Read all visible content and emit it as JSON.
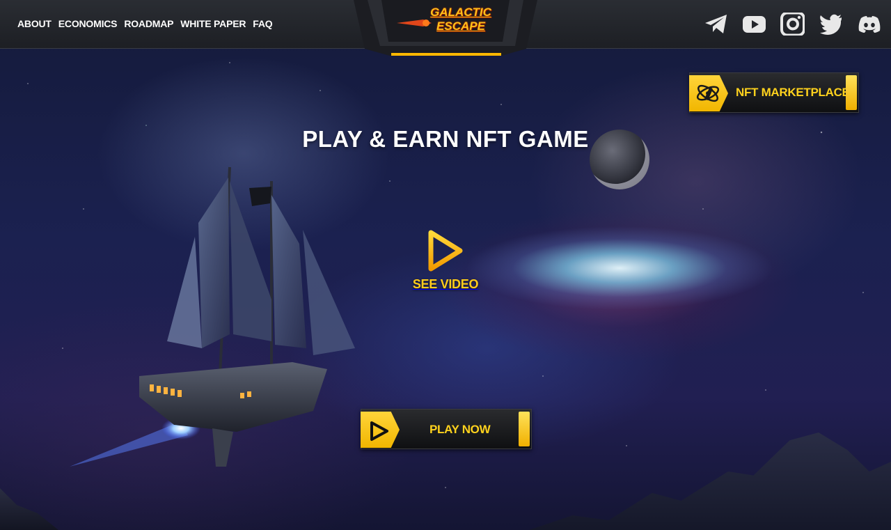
{
  "nav": {
    "items": [
      {
        "label": "ABOUT"
      },
      {
        "label": "ECONOMICS"
      },
      {
        "label": "ROADMAP"
      },
      {
        "label": "WHITE PAPER"
      },
      {
        "label": "FAQ"
      }
    ]
  },
  "logo": {
    "line1": "GALACTIC",
    "line2": "ESCAPE"
  },
  "socials": [
    {
      "icon": "telegram-icon"
    },
    {
      "icon": "youtube-icon"
    },
    {
      "icon": "instagram-icon"
    },
    {
      "icon": "twitter-icon"
    },
    {
      "icon": "discord-icon"
    }
  ],
  "hero": {
    "headline": "PLAY & EARN NFT GAME",
    "video_label": "SEE VIDEO",
    "play_label": "PLAY NOW"
  },
  "marketplace": {
    "label": "NFT MARKETPLACE",
    "icon": "atom-rocket-icon"
  },
  "colors": {
    "accent": "#ffd21d",
    "header_bg": "#24262b",
    "button_bg": "#1a1b1e"
  }
}
